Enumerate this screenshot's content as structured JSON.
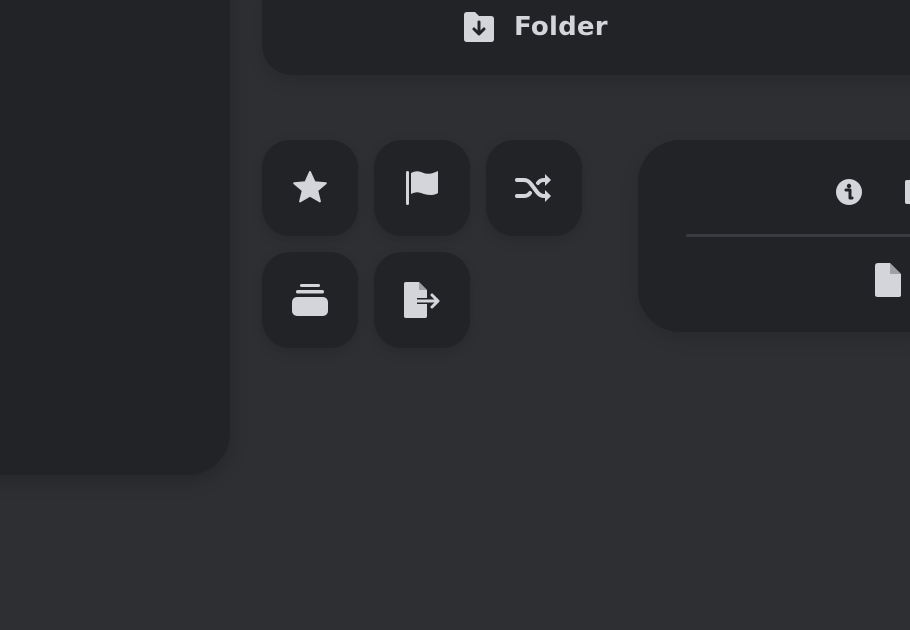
{
  "folder_card": {
    "icon": "folder-download-icon",
    "label": "Folder"
  },
  "icon_buttons": [
    {
      "icon": "star-icon"
    },
    {
      "icon": "flag-icon"
    },
    {
      "icon": "shuffle-icon"
    },
    {
      "icon": "stack-icon"
    },
    {
      "icon": "file-export-icon"
    }
  ],
  "right_card": {
    "icons": [
      "info-icon",
      "file-icon"
    ]
  },
  "colors": {
    "background": "#2e2f33",
    "card": "#222326",
    "icon": "#d4d5da",
    "divider": "#3a3b40"
  }
}
